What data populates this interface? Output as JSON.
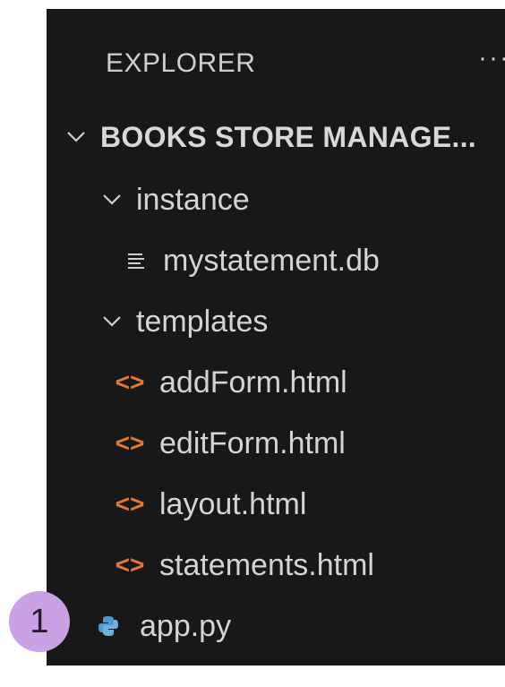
{
  "explorer": {
    "title": "EXPLORER",
    "more_label": "···",
    "root": "BOOKS STORE MANAGE...",
    "folders": [
      {
        "label": "instance"
      },
      {
        "label": "templates"
      }
    ],
    "files": [
      {
        "label": "mystatement.db",
        "icon": "database-lines-icon"
      },
      {
        "label": "addForm.html",
        "icon": "html-icon"
      },
      {
        "label": "editForm.html",
        "icon": "html-icon"
      },
      {
        "label": "layout.html",
        "icon": "html-icon"
      },
      {
        "label": "statements.html",
        "icon": "html-icon"
      },
      {
        "label": "app.py",
        "icon": "python-icon"
      }
    ],
    "html_icon_glyph": "<>",
    "colors": {
      "background": "#181818",
      "text": "#cccccc",
      "html_icon": "#e37933",
      "python_icon": "#4b9bd0",
      "badge": "#c9a2e6"
    }
  },
  "annotation": {
    "badge": "1"
  }
}
